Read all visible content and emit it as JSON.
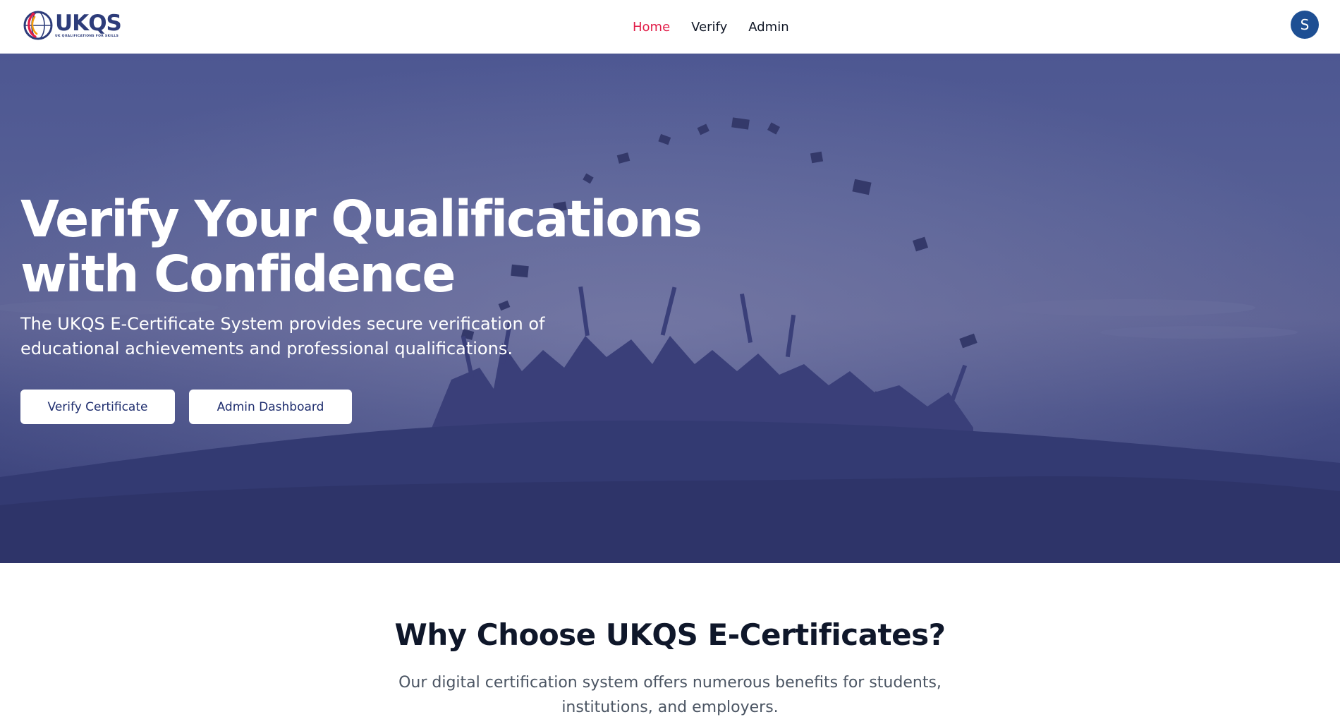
{
  "brand": {
    "name": "UKQS",
    "tagline": "UK QUALIFICATIONS FOR SKILLS",
    "colors": {
      "primary": "#2d3c7a",
      "accent_red": "#e11d48",
      "accent_orange": "#f59e0b"
    }
  },
  "nav": {
    "items": [
      {
        "label": "Home",
        "active": true
      },
      {
        "label": "Verify",
        "active": false
      },
      {
        "label": "Admin",
        "active": false
      }
    ]
  },
  "user": {
    "avatar_initial": "S",
    "avatar_color": "#1e4f93"
  },
  "hero": {
    "title": "Verify Your Qualifications with Confidence",
    "subtitle": "The UKQS E-Certificate System provides secure verification of educational achievements and professional qualifications.",
    "buttons": {
      "verify": "Verify Certificate",
      "admin": "Admin Dashboard"
    },
    "background": "graduates-silhouette-image",
    "overlay_color": "#3b4283"
  },
  "features": {
    "title": "Why Choose UKQS E-Certificates?",
    "subtitle": "Our digital certification system offers numerous benefits for students, institutions, and employers."
  }
}
